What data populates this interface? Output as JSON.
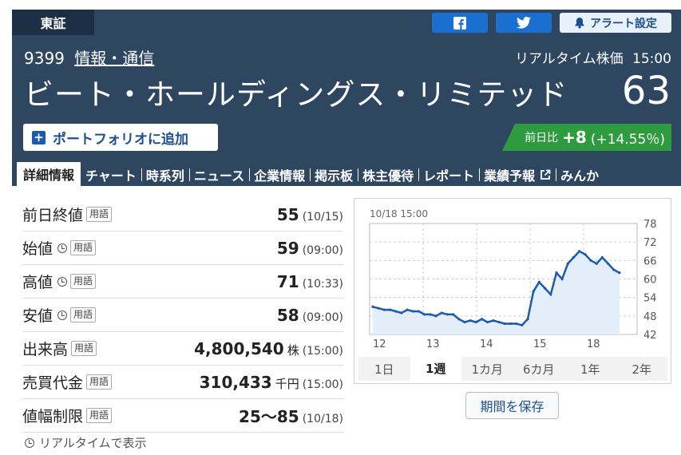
{
  "header": {
    "market": "東証",
    "alert_label": "アラート設定",
    "code": "9399",
    "industry": "情報・通信",
    "realtime_label": "リアルタイム株価",
    "time": "15:00",
    "company_name": "ビート・ホールディングス・リミテッド",
    "price": "63",
    "portfolio_button": "ポートフォリオに追加",
    "change_label": "前日比",
    "change_value": "+8",
    "change_pct": "(+14.55％)"
  },
  "nav_tabs": [
    "詳細情報",
    "チャート",
    "時系列",
    "ニュース",
    "企業情報",
    "掲示板",
    "株主優待",
    "レポート",
    "業績予報",
    "みんか"
  ],
  "stats": [
    {
      "label": "前日終値",
      "value": "55",
      "unit": "",
      "time": "(10/15)"
    },
    {
      "label": "始値",
      "value": "59",
      "unit": "",
      "time": "(09:00)"
    },
    {
      "label": "高値",
      "value": "71",
      "unit": "",
      "time": "(10:33)"
    },
    {
      "label": "安値",
      "value": "58",
      "unit": "",
      "time": "(09:00)"
    },
    {
      "label": "出来高",
      "value": "4,800,540",
      "unit": "株",
      "time": "(15:00)"
    },
    {
      "label": "売買代金",
      "value": "310,433",
      "unit": "千円",
      "time": "(15:00)"
    },
    {
      "label": "値幅制限",
      "value": "25～85",
      "unit": "",
      "time": "(10/18)"
    }
  ],
  "glossary_badge": "用語",
  "realtime_note": "リアルタイムで表示",
  "chart_data": {
    "type": "line",
    "title": "10/18 15:00",
    "y_ticks": [
      "78",
      "72",
      "66",
      "60",
      "54",
      "48",
      "42"
    ],
    "ylim": [
      42,
      78
    ],
    "x_ticks": [
      "12",
      "13",
      "14",
      "15",
      "18"
    ],
    "series": [
      {
        "values": [
          51,
          50.5,
          50,
          50,
          49.5,
          49,
          50,
          49.5,
          49.5,
          48.5,
          48.5,
          48,
          49,
          48.5,
          48.5,
          47,
          46,
          46.5,
          46,
          47,
          46,
          46.5,
          46,
          45.5,
          45.5,
          45.5,
          45,
          47,
          56,
          59,
          57,
          55,
          62,
          60,
          65,
          67,
          69,
          68,
          66,
          65,
          67,
          65,
          63,
          62
        ]
      }
    ],
    "color": "#1a5bb0"
  },
  "period_tabs": [
    "1日",
    "1週",
    "1カ月",
    "6カ月",
    "1年",
    "2年"
  ],
  "active_period": "1週",
  "save_button": "期間を保存"
}
